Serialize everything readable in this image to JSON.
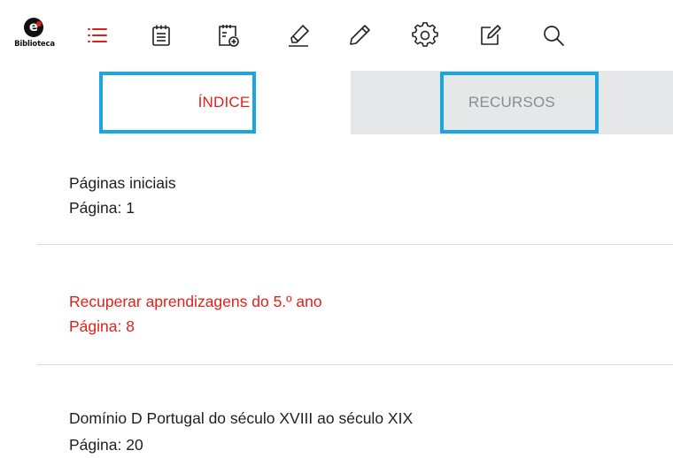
{
  "app": {
    "logo_letter": "e",
    "logo_text": "Biblioteca"
  },
  "toolbar": {
    "icons": [
      "list-icon",
      "notepad-icon",
      "add-document-icon",
      "highlighter-icon",
      "pencil-icon",
      "gear-icon",
      "edit-square-icon",
      "search-icon"
    ],
    "active_icon": "list-icon"
  },
  "tabs": {
    "indice": "ÍNDICE",
    "recursos": "RECURSOS",
    "active": "ÍNDICE"
  },
  "index": {
    "items": [
      {
        "title": "Páginas iniciais",
        "page": "Página: 1",
        "active": false
      },
      {
        "title": "Recuperar aprendizagens do 5.º ano",
        "page": "Página: 8",
        "active": true
      },
      {
        "title": "Domínio D Portugal do século XVIII ao século XIX",
        "page": "Página: 20",
        "active": false
      }
    ]
  },
  "colors": {
    "accent_red": "#e32119",
    "highlight_blue": "#1aa6e4",
    "inactive_tab_bg": "#e6e7e9",
    "inactive_tab_text": "#8a8b8d"
  }
}
